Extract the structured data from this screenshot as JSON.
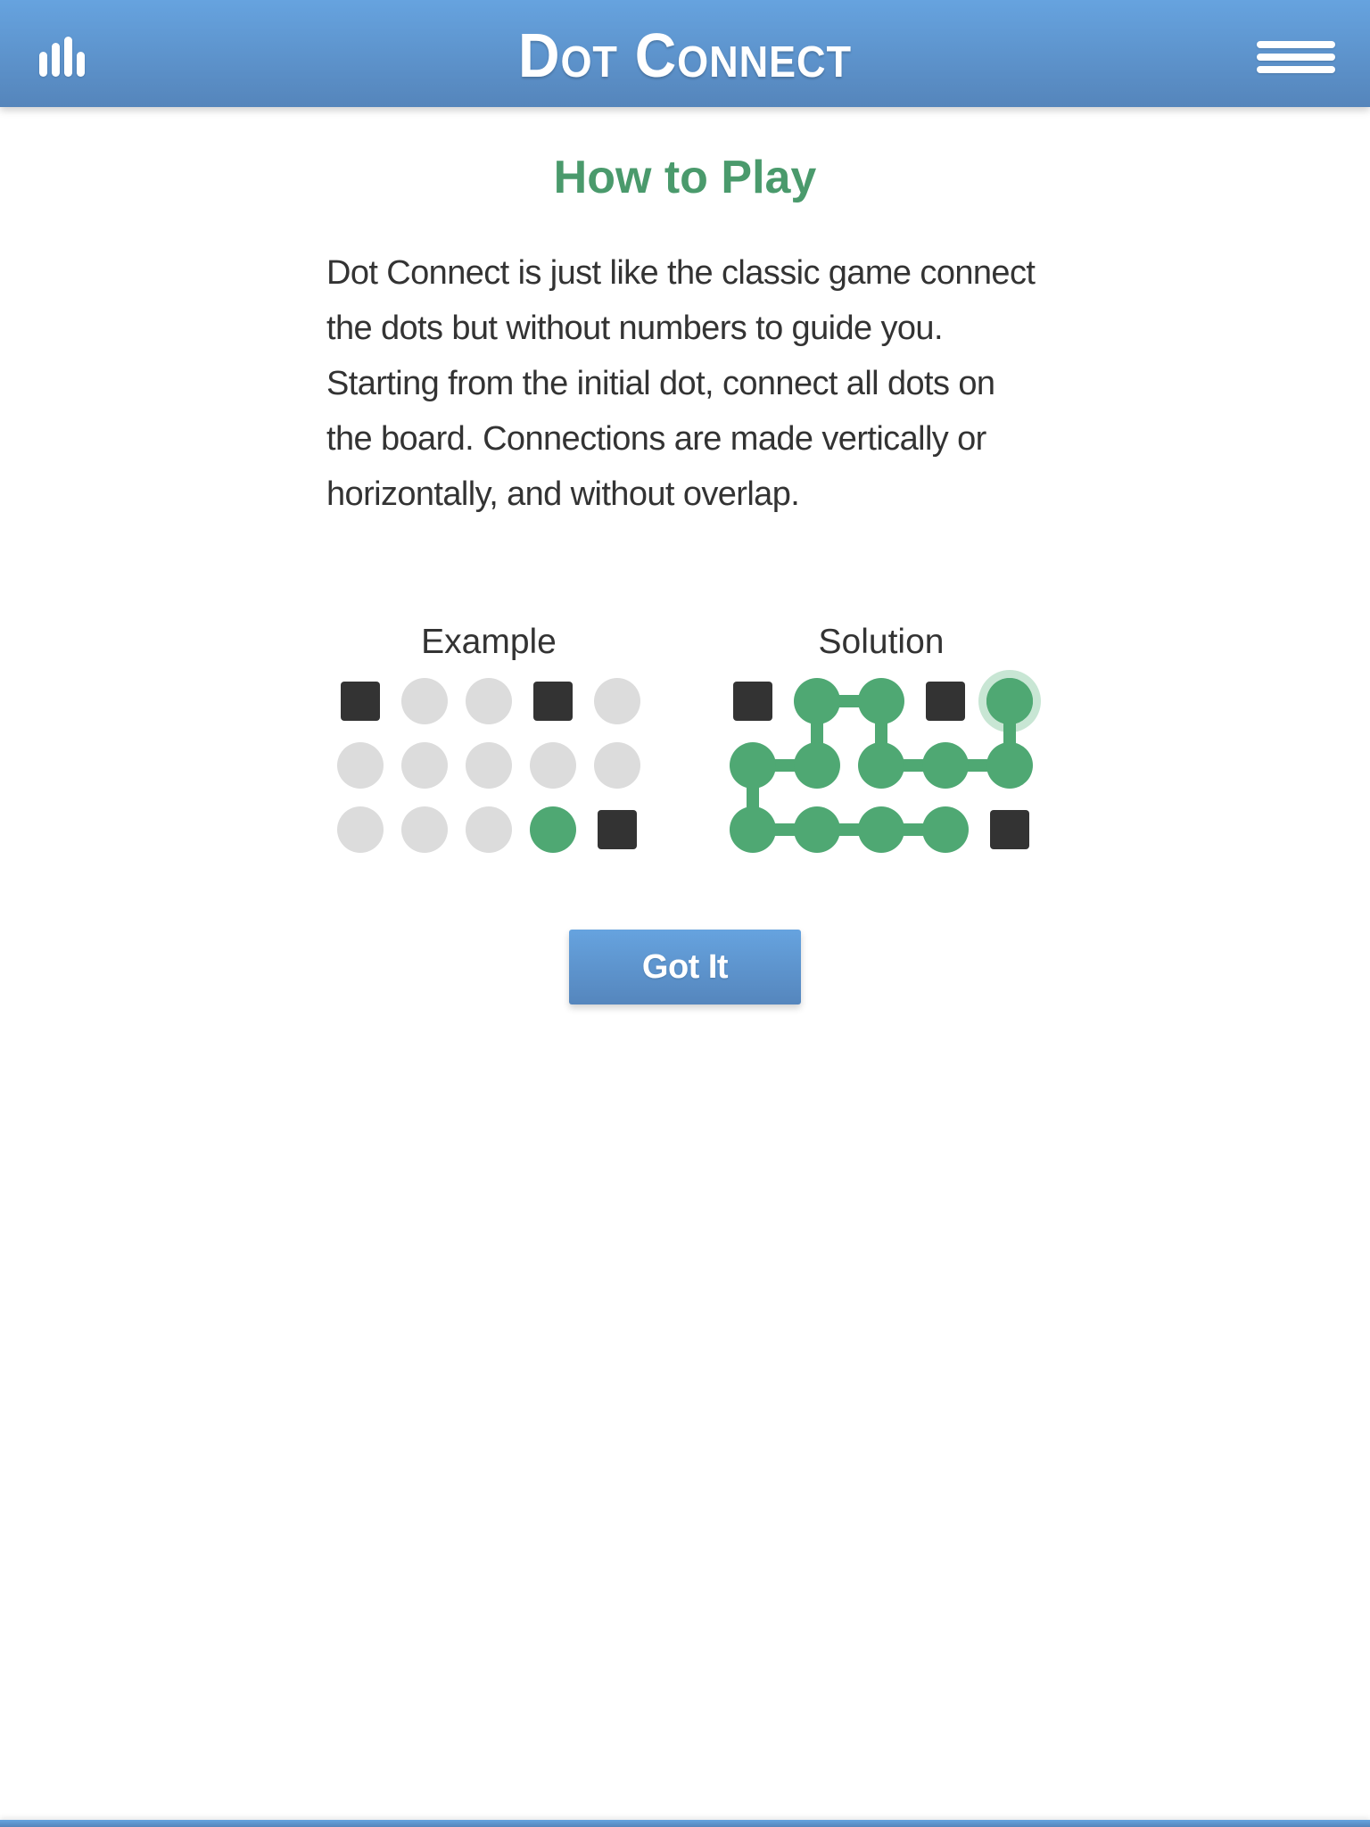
{
  "header": {
    "title": "Dot Connect",
    "left_icon": "stats-bars-icon",
    "right_icon": "hamburger-menu-icon"
  },
  "howto": {
    "title": "How to Play",
    "description": "Dot Connect is just like the classic game connect the dots but without numbers to guide you. Starting from the initial dot, connect all dots on the board. Connections are made vertically or horizontally, and without overlap."
  },
  "colors": {
    "header": "#5d93cd",
    "accent_green": "#4fa873",
    "title_green": "#4a9a6c",
    "blocked": "#333333",
    "empty_dot": "#dcdcdc",
    "halo": "#c8e6d4"
  },
  "example": {
    "label": "Example",
    "rows": 3,
    "cols": 5,
    "cells": [
      [
        "block",
        "empty",
        "empty",
        "block",
        "empty"
      ],
      [
        "empty",
        "empty",
        "empty",
        "empty",
        "empty"
      ],
      [
        "empty",
        "empty",
        "empty",
        "start",
        "block"
      ]
    ]
  },
  "solution": {
    "label": "Solution",
    "rows": 3,
    "cols": 5,
    "cells": [
      [
        "block",
        "filled",
        "filled",
        "block",
        "current"
      ],
      [
        "filled",
        "filled",
        "filled",
        "filled",
        "filled"
      ],
      [
        "filled",
        "filled",
        "filled",
        "filled",
        "block"
      ]
    ],
    "path": [
      [
        2,
        3
      ],
      [
        2,
        2
      ],
      [
        2,
        1
      ],
      [
        2,
        0
      ],
      [
        1,
        0
      ],
      [
        1,
        1
      ],
      [
        0,
        1
      ],
      [
        0,
        2
      ],
      [
        1,
        2
      ],
      [
        1,
        3
      ],
      [
        1,
        4
      ],
      [
        0,
        4
      ]
    ]
  },
  "button": {
    "label": "Got It"
  }
}
